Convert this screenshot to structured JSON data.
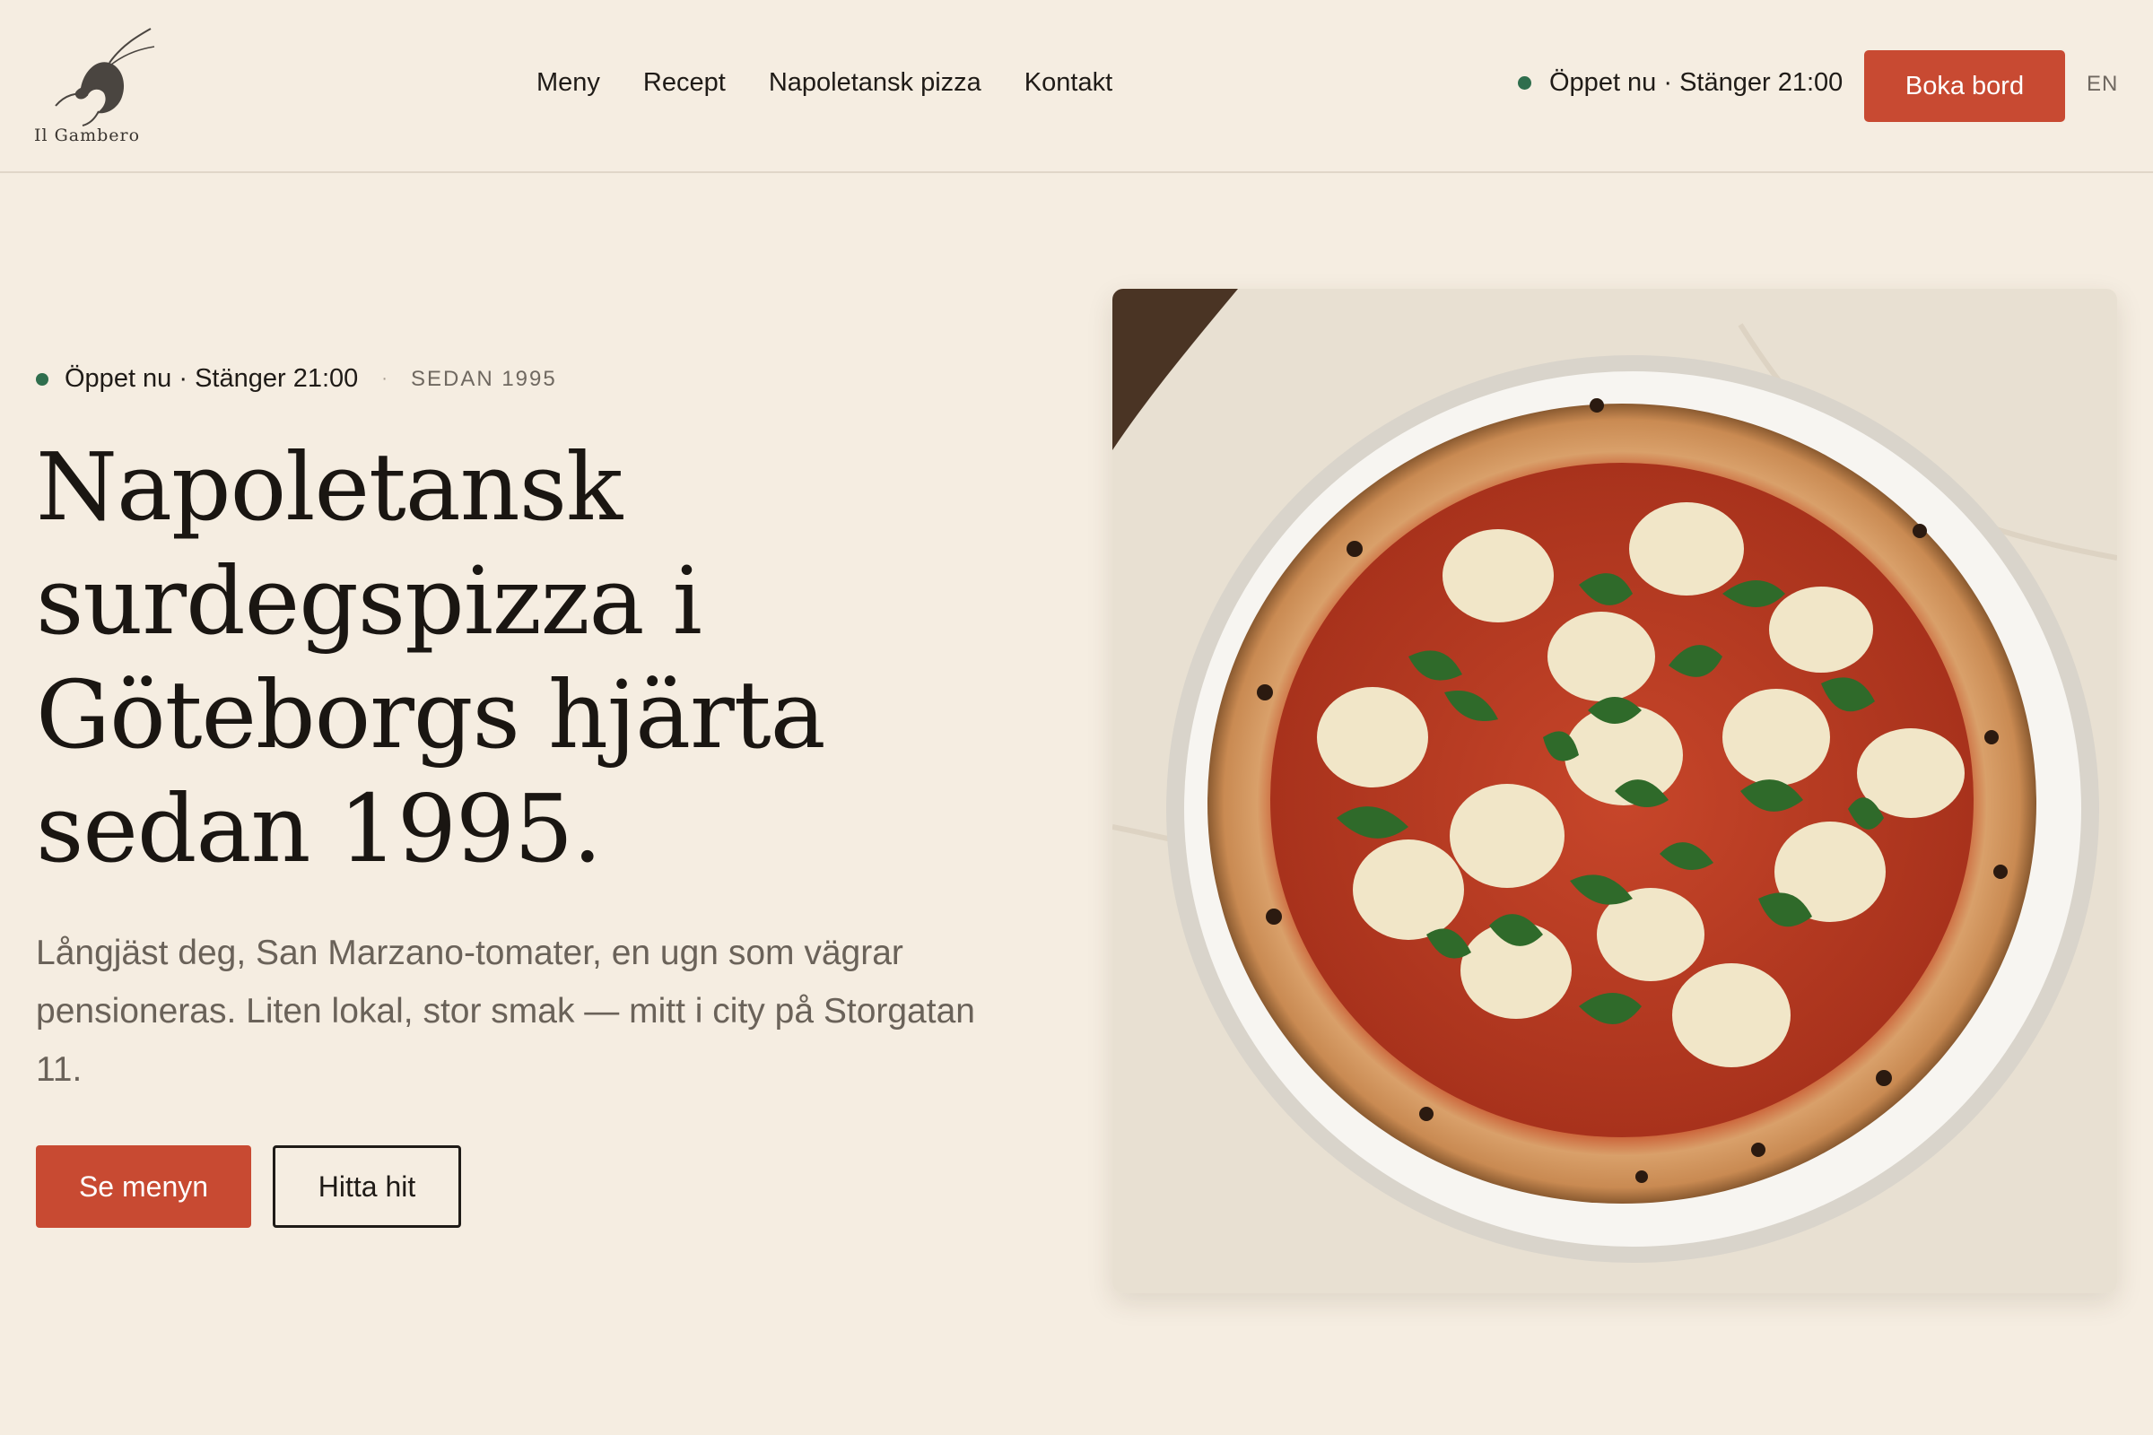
{
  "brand": {
    "name": "Il Gambero"
  },
  "nav": {
    "items": [
      "Meny",
      "Recept",
      "Napoletansk pizza",
      "Kontakt"
    ]
  },
  "header": {
    "status": "Öppet nu · Stänger 21:00",
    "book_label": "Boka bord",
    "lang_label": "EN"
  },
  "hero": {
    "status": "Öppet nu · Stänger 21:00",
    "separator": "·",
    "since": "SEDAN 1995",
    "headline_lines": [
      "Napoletansk",
      "surdegspizza i",
      "Göteborgs hjärta",
      "sedan 1995."
    ],
    "lead": "Långjäst deg, San Marzano-tomater, en ugn som vägrar pensioneras. Liten lokal, stor smak — mitt i city på Storgatan 11.",
    "primary_cta": "Se menyn",
    "secondary_cta": "Hitta hit"
  },
  "colors": {
    "background": "#f5ede1",
    "accent": "#c84a32",
    "status_green": "#2f6e4d",
    "text": "#1f1b17"
  },
  "icons": {
    "logo": "shrimp-logo-icon",
    "status": "status-dot-icon",
    "hero_image": "margherita-pizza-photo"
  }
}
